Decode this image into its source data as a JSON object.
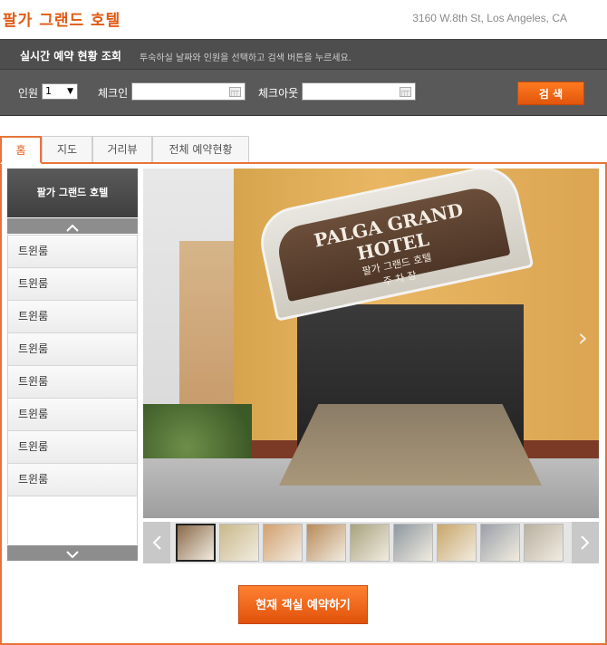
{
  "header": {
    "title": "팔가 그랜드 호텔",
    "address": "3160 W.8th St, Los Angeles, CA"
  },
  "search": {
    "title": "실시간 예약 현황 조회",
    "hint": "투숙하실 날짜와 인원을 선택하고 검색 버튼을 누르세요.",
    "guests_label": "인원",
    "guests_value": "1",
    "checkin_label": "체크인",
    "checkout_label": "체크아웃",
    "button": "검 색"
  },
  "tabs": [
    {
      "label": "홈",
      "active": true
    },
    {
      "label": "지도",
      "active": false
    },
    {
      "label": "거리뷰",
      "active": false
    },
    {
      "label": "전체 예약현황",
      "active": false
    }
  ],
  "sidebar": {
    "heading": "팔가 그랜드 호텔",
    "items": [
      "트윈룸",
      "트윈룸",
      "트윈룸",
      "트윈룸",
      "트윈룸",
      "트윈룸",
      "트윈룸",
      "트윈룸"
    ]
  },
  "photo": {
    "sign_title": "PALGA GRAND HOTEL",
    "sign_korean": "팔가 그랜드 호텔",
    "sign_parking": "주 차 장"
  },
  "thumbnails": [
    {
      "color": "#8a6a4a",
      "active": true
    },
    {
      "color": "#c9b88a"
    },
    {
      "color": "#d2a070"
    },
    {
      "color": "#b88a5a"
    },
    {
      "color": "#a7a27e"
    },
    {
      "color": "#8e98a0"
    },
    {
      "color": "#c8a66a"
    },
    {
      "color": "#9aa0a8"
    },
    {
      "color": "#b8b0a0"
    }
  ],
  "book_button": "현재 객실 예약하기",
  "colors": {
    "accent": "#e05a14",
    "bar": "#595959"
  }
}
